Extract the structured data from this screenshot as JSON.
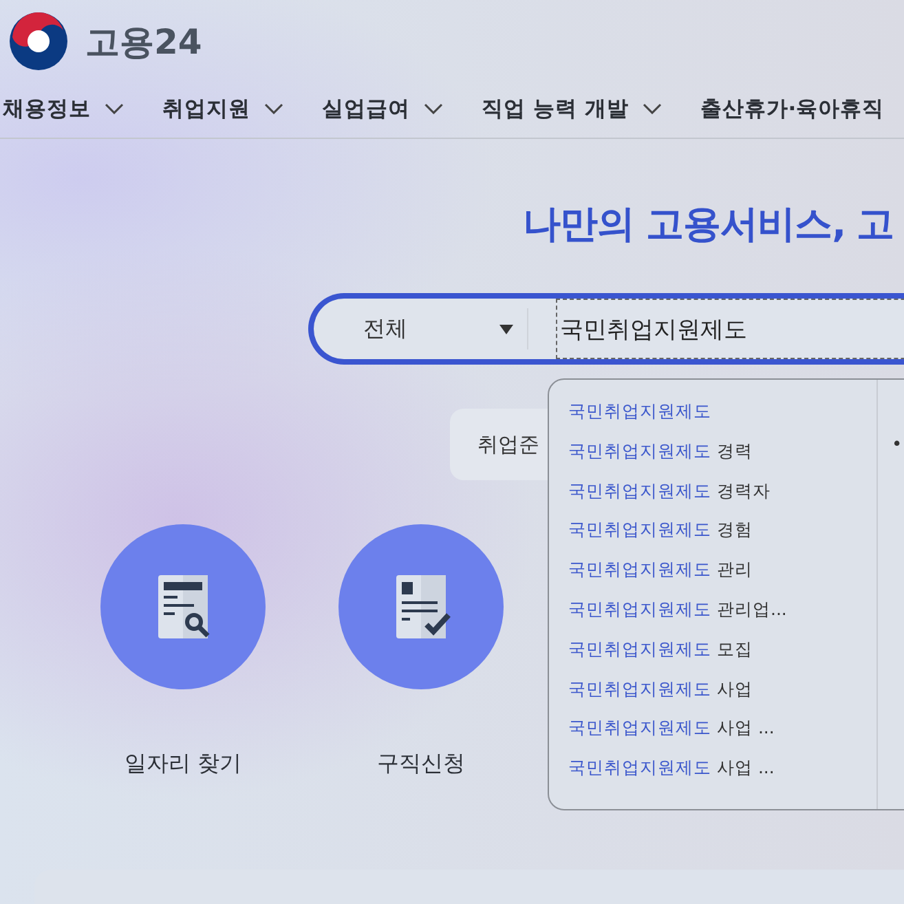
{
  "logo": {
    "text": "고용24"
  },
  "nav": [
    {
      "label": "채용정보",
      "has_menu": true
    },
    {
      "label": "취업지원",
      "has_menu": true
    },
    {
      "label": "실업급여",
      "has_menu": true
    },
    {
      "label": "직업 능력 개발",
      "has_menu": true
    },
    {
      "label": "출산휴가·육아휴직",
      "has_menu": false
    }
  ],
  "hero": {
    "headline": "나만의 고용서비스, 고"
  },
  "search": {
    "category": "전체",
    "value": "국민취업지원제도"
  },
  "chips": [
    {
      "label": "취업준"
    }
  ],
  "suggestions": [
    {
      "match": "국민취업지원제도"
    },
    {
      "match": "국민취업지원제도",
      "rest": "경력"
    },
    {
      "match": "국민취업지원제도",
      "rest": "경력자"
    },
    {
      "match": "국민취업지원제도",
      "rest": "경험"
    },
    {
      "match": "국민취업지원제도",
      "rest": "관리"
    },
    {
      "match": "국민취업지원제도",
      "rest": "관리업..."
    },
    {
      "match": "국민취업지원제도",
      "rest": "모집"
    },
    {
      "match": "국민취업지원제도",
      "rest": "사업"
    },
    {
      "match": "국민취업지원제도",
      "rest": "사업 ..."
    },
    {
      "match": "국민취업지원제도",
      "rest": "사업 ..."
    }
  ],
  "side_panel": {
    "bullet": "•"
  },
  "services": [
    {
      "label": "일자리 찾기",
      "kind": "search"
    },
    {
      "label": "구직신청",
      "kind": "check"
    }
  ]
}
